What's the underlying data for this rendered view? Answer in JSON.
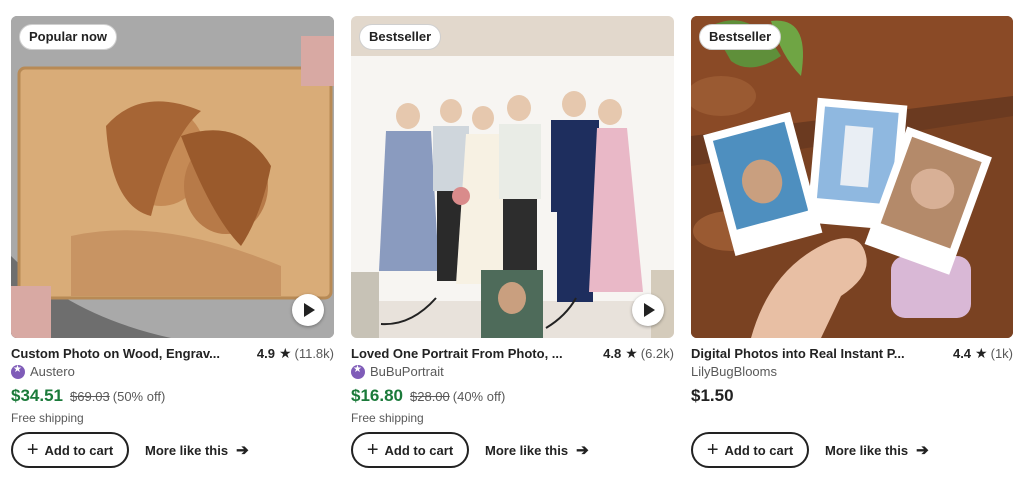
{
  "products": [
    {
      "badge": "Popular now",
      "title": "Custom Photo on Wood, Engrav...",
      "rating": "4.9",
      "review_count": "(11.8k)",
      "shop": "Austero",
      "star_seller": true,
      "price": "$34.51",
      "original_price": "$69.03",
      "discount": "(50% off)",
      "shipping": "Free shipping",
      "add_to_cart": "Add to cart",
      "more_like_this": "More like this",
      "has_video": true,
      "image_icon": "wood-engraved-photo-image"
    },
    {
      "badge": "Bestseller",
      "title": "Loved One Portrait From Photo, ...",
      "rating": "4.8",
      "review_count": "(6.2k)",
      "shop": "BuBuPortrait",
      "star_seller": true,
      "price": "$16.80",
      "original_price": "$28.00",
      "discount": "(40% off)",
      "shipping": "Free shipping",
      "add_to_cart": "Add to cart",
      "more_like_this": "More like this",
      "has_video": true,
      "image_icon": "family-portrait-illustration-image"
    },
    {
      "badge": "Bestseller",
      "title": "Digital Photos into Real Instant P...",
      "rating": "4.4",
      "review_count": "(1k)",
      "shop": "LilyBugBlooms",
      "star_seller": false,
      "price": "$1.50",
      "original_price": "",
      "discount": "",
      "shipping": "",
      "add_to_cart": "Add to cart",
      "more_like_this": "More like this",
      "has_video": false,
      "image_icon": "instant-photo-prints-image"
    }
  ],
  "colors": {
    "sale_price": "#1b7a3a",
    "star_seller": "#7f5cb8",
    "text": "#222222",
    "muted": "#595959"
  }
}
